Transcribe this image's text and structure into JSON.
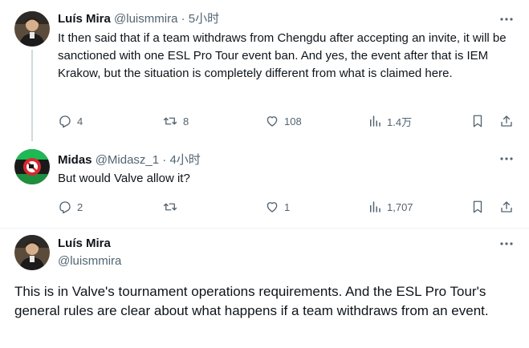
{
  "tweet1": {
    "name": "Luís Mira",
    "handle": "@luismmira",
    "sep": "·",
    "time": "5小时",
    "text": "It then said that if a team withdraws from Chengdu after accepting an invite, it will be sanctioned with one ESL Pro Tour event ban. And yes, the event after that is IEM Krakow, but the situation is completely different from what is claimed here.",
    "replies": "4",
    "retweets": "8",
    "likes": "108",
    "views": "1.4万"
  },
  "tweet2": {
    "name": "Midas",
    "handle": "@Midasz_1",
    "sep": "·",
    "time": "4小时",
    "text": "But would Valve allow it?",
    "replies": "2",
    "retweets": "",
    "likes": "1",
    "views": "1,707"
  },
  "tweet3": {
    "name": "Luís Mira",
    "handle": "@luismmira",
    "text": "This is in Valve's tournament operations requirements. And the ESL Pro Tour's general rules are clear about what happens if a team withdraws from an event."
  },
  "icons": {
    "reply": "reply-icon",
    "retweet": "retweet-icon",
    "like": "heart-icon",
    "views": "views-icon",
    "bookmark": "bookmark-icon",
    "share": "share-icon",
    "more": "more-icon"
  },
  "colors": {
    "text": "#0f1419",
    "secondary": "#536471",
    "divider": "#eff3f4"
  }
}
